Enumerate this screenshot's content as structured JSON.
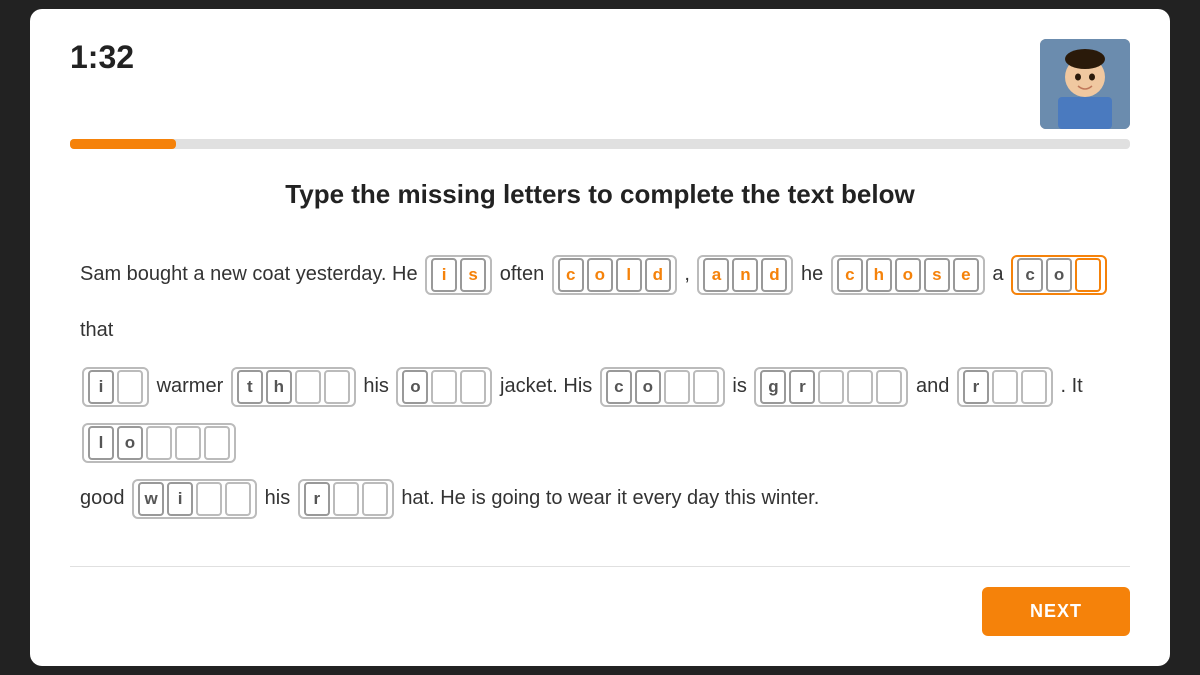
{
  "timer": "1:32",
  "progress": 10,
  "instructions": "Type the missing letters to complete the text below",
  "next_button": "NEXT",
  "sentence": {
    "line1_prefix": "Sam bought a new coat yesterday. He",
    "line1_suffix": "that",
    "line2_prefix": "warmer",
    "line2_mid1": "his",
    "line2_mid2": "jacket. His",
    "line2_mid3": "is",
    "line2_mid4": "and",
    "line2_suffix": ". It",
    "line3_prefix": "good",
    "line3_mid": "his",
    "line3_suffix": "hat. He is going to wear it every day this winter."
  }
}
